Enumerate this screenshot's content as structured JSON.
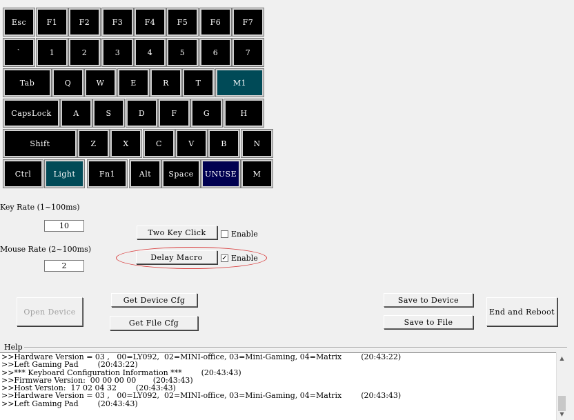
{
  "keyboard": {
    "row1": [
      "Esc",
      "F1",
      "F2",
      "F3",
      "F4",
      "F5",
      "F6",
      "F7"
    ],
    "row2": [
      "`",
      "1",
      "2",
      "3",
      "4",
      "5",
      "6",
      "7"
    ],
    "row3": [
      "Tab",
      "Q",
      "W",
      "E",
      "R",
      "T",
      "M1"
    ],
    "row4": [
      "CapsLock",
      "A",
      "S",
      "D",
      "F",
      "G",
      "H"
    ],
    "row5": [
      "Shift",
      "Z",
      "X",
      "C",
      "V",
      "B",
      "N"
    ],
    "row6": [
      "Ctrl",
      "Light",
      "Fn1",
      "Alt",
      "Space",
      "UNUSE",
      "M"
    ]
  },
  "settings": {
    "key_rate_label": "Key Rate (1~100ms)",
    "key_rate_value": "10",
    "mouse_rate_label": "Mouse Rate (2~100ms)",
    "mouse_rate_value": "2",
    "two_key_click_label": "Two Key Click",
    "two_key_enable_label": "Enable",
    "two_key_enabled": false,
    "delay_macro_label": "Delay Macro",
    "delay_macro_enable_label": "Enable",
    "delay_macro_enabled": true,
    "check_mark": "✓"
  },
  "actions": {
    "open_device": "Open Device",
    "get_device_cfg": "Get Device Cfg",
    "get_file_cfg": "Get File Cfg",
    "save_to_device": "Save to Device",
    "save_to_file": "Save to File",
    "end_and_reboot": "End and Reboot"
  },
  "help": {
    "title": "Help",
    "lines": [
      ">>Hardware Version = 03 ,   00=LY092,  02=MINI-office, 03=Mini-Gaming, 04=Matrix        (20:43:22)",
      ">>Left Gaming Pad        (20:43:22)",
      ">>*** Keyboard Configuration Information ***        (20:43:43)",
      ">>Firmware Version:  00 00 00 00       (20:43:43)",
      ">>Host Version:  17 02 04 32        (20:43:43)",
      ">>Hardware Version = 03 ,   00=LY092,  02=MINI-office, 03=Mini-Gaming, 04=Matrix        (20:43:43)",
      ">>Left Gaming Pad        (20:43:43)"
    ],
    "scroll_up_icon": "▲",
    "scroll_down_icon": "▼"
  },
  "colors": {
    "key_bg": "#000000",
    "key_teal": "#004a57",
    "key_navy": "#000050",
    "highlight_ellipse": "#d94040"
  }
}
